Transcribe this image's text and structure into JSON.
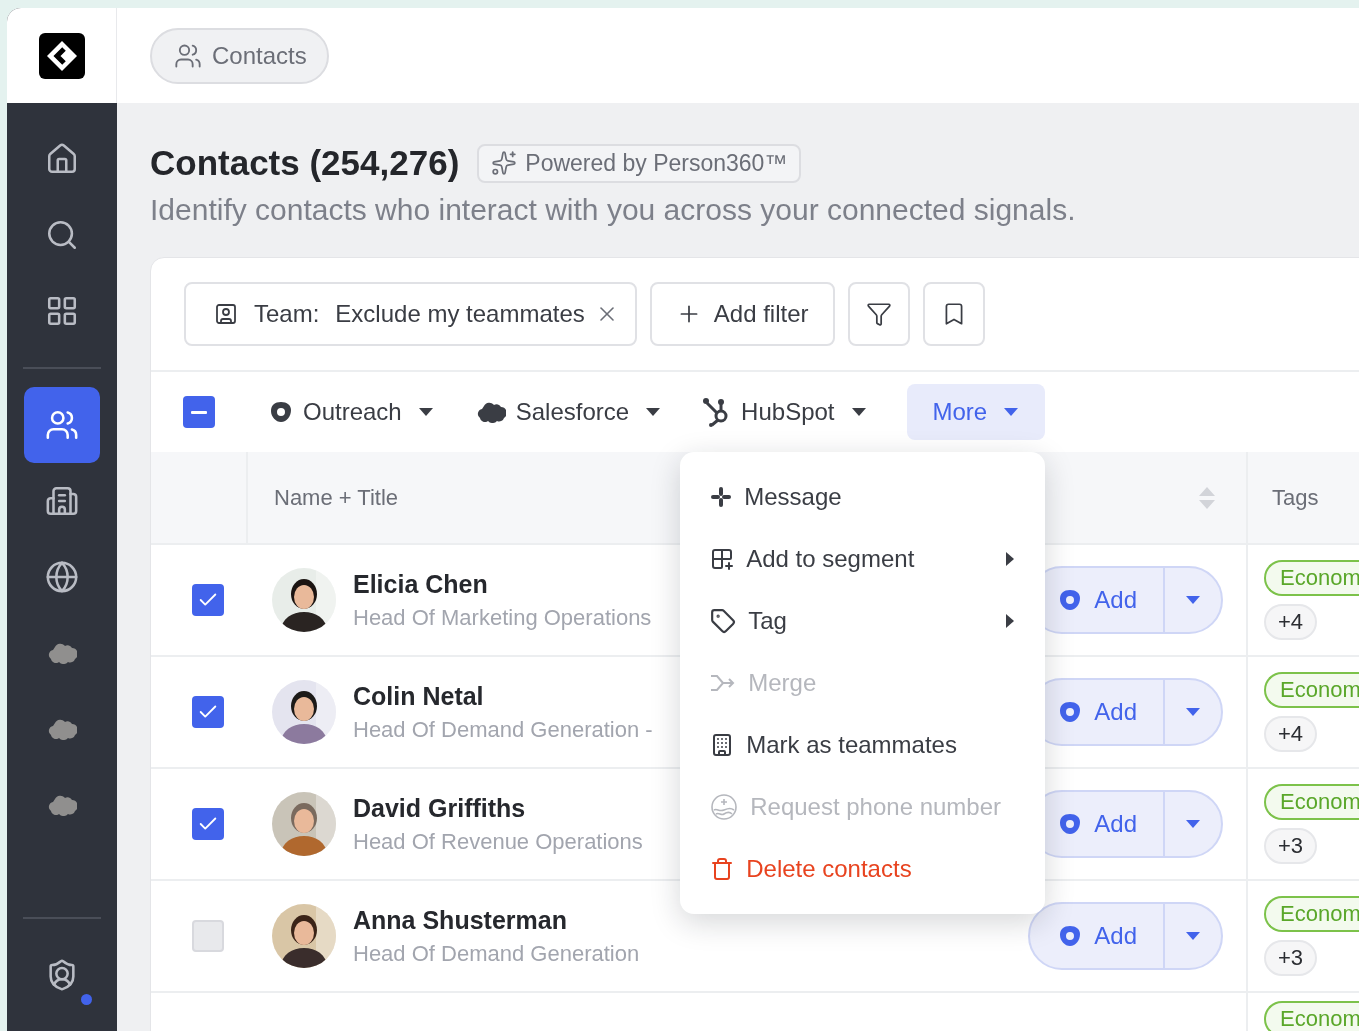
{
  "nav_groups": [
    {
      "items": [
        {
          "selected": false,
          "notification": false
        },
        {
          "selected": false,
          "notification": false
        },
        {
          "selected": false,
          "notification": false
        }
      ]
    },
    {
      "items": [
        {
          "selected": true,
          "notification": false
        },
        {
          "selected": false,
          "notification": false
        },
        {
          "selected": false,
          "notification": false
        },
        {
          "selected": false,
          "notification": false
        },
        {
          "selected": false,
          "notification": false
        },
        {
          "selected": false,
          "notification": false
        }
      ]
    },
    {
      "items": [
        {
          "selected": false,
          "notification": true
        }
      ]
    }
  ],
  "breadcrumb": {
    "label": "Contacts"
  },
  "header": {
    "title": "Contacts (254,276)",
    "badge": "Powered by Person360™",
    "subtitle": "Identify contacts who interact with you across your connected signals."
  },
  "filters": {
    "chips": [
      {
        "key": "Team:",
        "value": "Exclude my teammates"
      }
    ],
    "add_filter": "Add filter"
  },
  "actions": {
    "select_all": {
      "indeterminate": true
    },
    "buttons": [
      {
        "label": "Outreach",
        "selected": false
      },
      {
        "label": "Salesforce",
        "selected": false
      },
      {
        "label": "HubSpot",
        "selected": false
      },
      {
        "label": "More",
        "selected": true
      }
    ]
  },
  "menu": {
    "items": [
      {
        "label": "Message",
        "kind": "normal",
        "disabled": false,
        "submenu": false
      },
      {
        "label": "Add to segment",
        "kind": "normal",
        "disabled": false,
        "submenu": true
      },
      {
        "label": "Tag",
        "kind": "normal",
        "disabled": false,
        "submenu": true
      },
      {
        "label": "Merge",
        "kind": "normal",
        "disabled": true,
        "submenu": false
      },
      {
        "label": "Mark as teammates",
        "kind": "normal",
        "disabled": false,
        "submenu": false
      },
      {
        "label": "Request phone number",
        "kind": "normal",
        "disabled": true,
        "submenu": false
      },
      {
        "label": "Delete contacts",
        "kind": "danger",
        "disabled": false,
        "submenu": false
      }
    ]
  },
  "table": {
    "columns": [
      "Name + Title",
      "Tags"
    ],
    "rows": [
      {
        "checked": true,
        "name": "Elicia Chen",
        "title": "Head Of Marketing Operations",
        "action": "Add",
        "tag": "Econom",
        "more": "+4"
      },
      {
        "checked": true,
        "name": "Colin Netal",
        "title": "Head Of Demand Generation -",
        "action": "Add",
        "tag": "Econom",
        "more": "+4"
      },
      {
        "checked": true,
        "name": "David Griffiths",
        "title": "Head Of Revenue Operations",
        "action": "Add",
        "tag": "Econom",
        "more": "+3"
      },
      {
        "checked": false,
        "name": "Anna Shusterman",
        "title": "Head Of Demand Generation",
        "action": "Add",
        "tag": "Econom",
        "more": "+3"
      }
    ],
    "partial_row": {
      "tag": "Econom"
    }
  }
}
